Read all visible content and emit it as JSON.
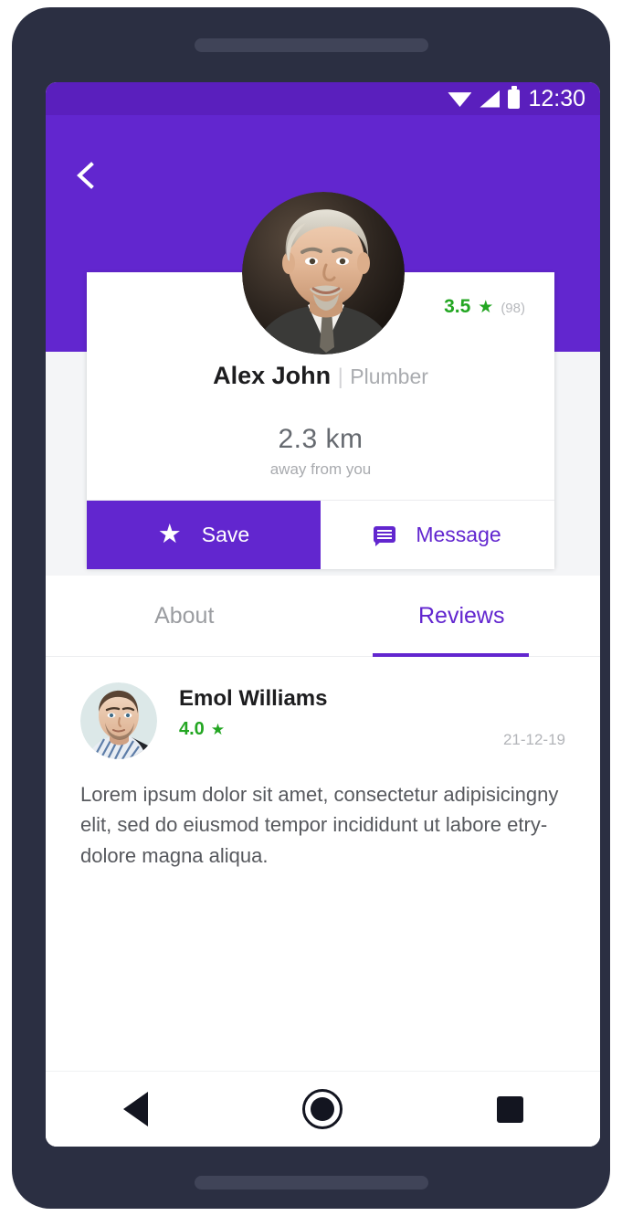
{
  "status_bar": {
    "time": "12:30",
    "icons": [
      "wifi-icon",
      "signal-icon",
      "battery-icon"
    ]
  },
  "header": {
    "back_icon": "chevron-left-icon",
    "background_color": "#6226cf"
  },
  "profile": {
    "avatar": "profile-photo-alex-john",
    "rating_value": "3.5",
    "rating_star": "★",
    "rating_count": "(98)",
    "name": "Alex John",
    "separator": "|",
    "role": "Plumber",
    "distance_value": "2.3 km",
    "distance_caption": "away from you",
    "rating_color": "#23a622"
  },
  "actions": {
    "save_label": "Save",
    "save_icon": "star-icon",
    "save_glyph": "★",
    "message_label": "Message",
    "message_icon": "chat-bubble-icon"
  },
  "tabs": [
    {
      "label": "About",
      "active": false
    },
    {
      "label": "Reviews",
      "active": true
    }
  ],
  "reviews": [
    {
      "avatar": "reviewer-photo-emol-williams",
      "name": "Emol Williams",
      "rating": "4.0",
      "rating_star": "★",
      "date": "21-12-19",
      "text": "Lorem ipsum dolor sit amet, consectetur adipisicingny elit, sed do eiusmod tempor incididunt ut labore etry-dolore magna aliqua."
    }
  ],
  "navbar": {
    "back": "back-triangle-icon",
    "home": "home-circle-icon",
    "recents": "recents-square-icon"
  }
}
